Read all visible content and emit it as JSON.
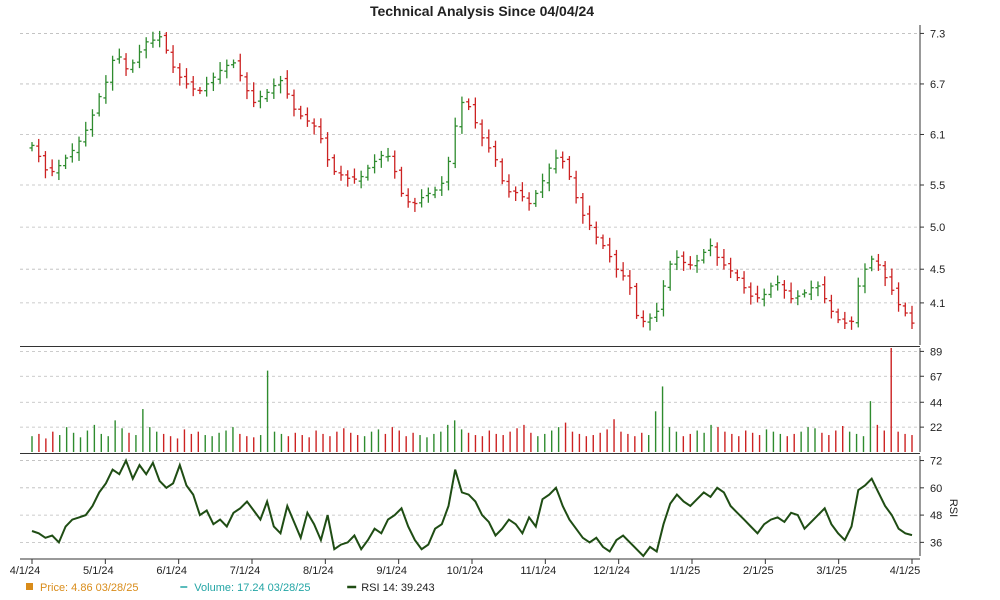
{
  "chart_data": {
    "type": "ohlc",
    "title": "Technical Analysis Since 04/04/24",
    "colors": {
      "up": "#2e8b2e",
      "down": "#cc2222",
      "rsi": "#1f4d14",
      "price_legend": "#d98c1a",
      "volume_legend": "#23a5a5",
      "rsi_legend": "#1f4d14"
    },
    "x_ticks": [
      "4/1/24",
      "5/1/24",
      "6/1/24",
      "7/1/24",
      "8/1/24",
      "9/1/24",
      "10/1/24",
      "11/1/24",
      "12/1/24",
      "1/1/25",
      "2/1/25",
      "3/1/25",
      "4/1/25"
    ],
    "price_panel": {
      "ylim": [
        3.6,
        7.4
      ],
      "ticks": [
        "7.3",
        "6.7",
        "6.1",
        "5.5",
        "5.0",
        "4.5",
        "4.1"
      ]
    },
    "volume_panel": {
      "ylim": [
        0,
        92
      ],
      "ticks": [
        "89",
        "67",
        "44",
        "22"
      ]
    },
    "rsi_panel": {
      "ylim": [
        30,
        74
      ],
      "ticks": [
        "72",
        "60",
        "48",
        "36"
      ],
      "label": "RSI"
    },
    "close_series": [
      5.97,
      5.84,
      5.68,
      5.66,
      5.73,
      5.82,
      5.91,
      6.02,
      6.15,
      6.33,
      6.55,
      6.72,
      6.98,
      7.02,
      6.88,
      6.95,
      7.08,
      7.2,
      7.22,
      7.26,
      7.1,
      6.9,
      6.78,
      6.7,
      6.64,
      6.62,
      6.7,
      6.78,
      6.86,
      6.92,
      6.95,
      6.8,
      6.62,
      6.48,
      6.55,
      6.6,
      6.68,
      6.74,
      6.58,
      6.4,
      6.32,
      6.26,
      6.2,
      6.05,
      5.8,
      5.66,
      5.62,
      5.58,
      5.57,
      5.6,
      5.7,
      5.78,
      5.85,
      5.84,
      5.66,
      5.4,
      5.3,
      5.28,
      5.35,
      5.4,
      5.44,
      5.52,
      5.78,
      6.2,
      6.48,
      6.43,
      6.24,
      6.06,
      5.94,
      5.8,
      5.55,
      5.42,
      5.41,
      5.36,
      5.28,
      5.4,
      5.55,
      5.7,
      5.82,
      5.78,
      5.6,
      5.35,
      5.14,
      5.02,
      4.88,
      4.78,
      4.65,
      4.5,
      4.42,
      4.28,
      3.95,
      3.88,
      3.92,
      4.0,
      4.3,
      4.56,
      4.64,
      4.58,
      4.55,
      4.6,
      4.7,
      4.78,
      4.64,
      4.55,
      4.48,
      4.4,
      4.28,
      4.18,
      4.16,
      4.2,
      4.3,
      4.34,
      4.25,
      4.15,
      4.18,
      4.22,
      4.28,
      4.3,
      4.15,
      4.0,
      3.9,
      3.86,
      3.88,
      4.3,
      4.5,
      4.62,
      4.55,
      4.4,
      4.25,
      4.08,
      3.98,
      3.86
    ],
    "volume_series": [
      14,
      16,
      12,
      18,
      15,
      22,
      17,
      13,
      19,
      24,
      16,
      14,
      28,
      21,
      17,
      15,
      38,
      22,
      18,
      16,
      14,
      12,
      20,
      16,
      18,
      15,
      14,
      17,
      19,
      22,
      16,
      14,
      13,
      15,
      72,
      18,
      16,
      14,
      17,
      15,
      13,
      19,
      16,
      14,
      18,
      21,
      17,
      15,
      14,
      18,
      20,
      16,
      22,
      19,
      14,
      17,
      15,
      13,
      16,
      18,
      24,
      28,
      20,
      17,
      15,
      14,
      19,
      16,
      15,
      18,
      21,
      24,
      17,
      14,
      16,
      19,
      22,
      26,
      18,
      16,
      14,
      15,
      17,
      20,
      29,
      18,
      16,
      14,
      17,
      15,
      36,
      58,
      22,
      18,
      14,
      16,
      19,
      17,
      24,
      22,
      18,
      16,
      14,
      19,
      17,
      15,
      20,
      18,
      16,
      14,
      16,
      18,
      22,
      21,
      17,
      15,
      19,
      23,
      18,
      16,
      14,
      45,
      24,
      19,
      92,
      18,
      16,
      15
    ],
    "rsi_series": [
      41,
      40,
      38,
      39,
      36,
      43,
      46,
      47,
      48,
      52,
      58,
      62,
      68,
      66,
      72,
      64,
      70,
      66,
      71,
      63,
      60,
      62,
      70,
      61,
      57,
      48,
      50,
      44,
      46,
      43,
      49,
      51,
      54,
      50,
      46,
      54,
      43,
      40,
      52,
      45,
      38,
      49,
      44,
      37,
      48,
      33,
      35,
      36,
      39,
      33,
      37,
      42,
      40,
      46,
      48,
      51,
      43,
      37,
      33,
      35,
      42,
      44,
      52,
      68,
      58,
      57,
      54,
      48,
      45,
      39,
      42,
      46,
      44,
      40,
      47,
      43,
      55,
      57,
      60,
      52,
      46,
      42,
      38,
      36,
      38,
      34,
      32,
      37,
      39,
      36,
      33,
      30,
      34,
      32,
      44,
      53,
      57,
      54,
      52,
      55,
      58,
      56,
      60,
      58,
      52,
      49,
      46,
      43,
      40,
      44,
      46,
      47,
      45,
      49,
      48,
      42,
      45,
      48,
      51,
      44,
      40,
      37,
      43,
      59,
      61,
      64,
      58,
      52,
      48,
      42,
      40,
      39.2
    ],
    "legend": [
      {
        "label": "Price: 4.86  03/28/25",
        "color_key": "price_legend",
        "marker": "square"
      },
      {
        "label": "Volume: 17.24  03/28/25",
        "color_key": "volume_legend",
        "marker": "dash"
      },
      {
        "label": "RSI 14: 39.243",
        "color_key": "rsi_legend",
        "marker": "line"
      }
    ]
  }
}
